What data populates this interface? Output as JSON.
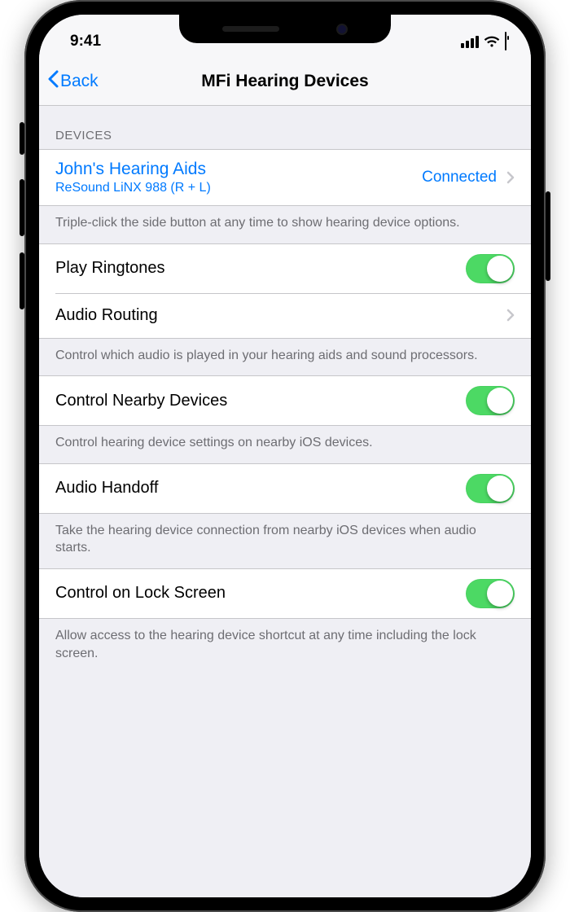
{
  "status": {
    "time": "9:41"
  },
  "nav": {
    "back": "Back",
    "title": "MFi Hearing Devices"
  },
  "devices": {
    "header": "Devices",
    "item": {
      "name": "John's Hearing Aids",
      "detail": "ReSound LiNX 988 (R + L)",
      "status": "Connected"
    },
    "footer": "Triple-click the side button at any time to show hearing device options."
  },
  "sections": {
    "playRingtones": {
      "label": "Play Ringtones",
      "on": true
    },
    "audioRouting": {
      "label": "Audio Routing",
      "footer": "Control which audio is played in your hearing aids and sound processors."
    },
    "controlNearby": {
      "label": "Control Nearby Devices",
      "on": true,
      "footer": "Control hearing device settings on nearby iOS devices."
    },
    "audioHandoff": {
      "label": "Audio Handoff",
      "on": true,
      "footer": "Take the hearing device connection from nearby iOS devices when audio starts."
    },
    "controlLock": {
      "label": "Control on Lock Screen",
      "on": true,
      "footer": "Allow access to the hearing device shortcut at any time including the lock screen."
    }
  }
}
